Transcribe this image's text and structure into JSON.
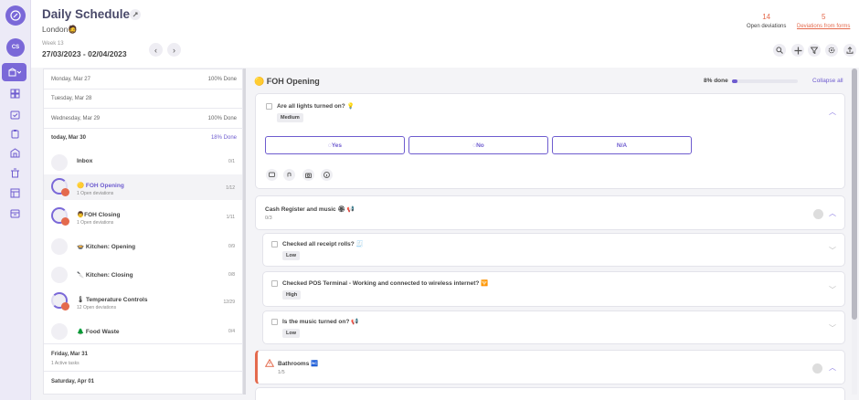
{
  "header": {
    "title": "Daily Schedule",
    "location": "London🧔",
    "week_label": "Week 13",
    "date_range": "27/03/2023 - 02/04/2023",
    "open_deviations_count": "14",
    "open_deviations_label": "Open deviations",
    "form_deviations_count": "5",
    "form_deviations_label": "Deviations from forms"
  },
  "user": {
    "initials": "CS"
  },
  "days": [
    {
      "name": "Monday, Mar 27",
      "pct": "100% Done"
    },
    {
      "name": "Tuesday, Mar 28",
      "pct": ""
    },
    {
      "name": "Wednesday, Mar 29",
      "pct": "100% Done"
    },
    {
      "name": "today, Mar 30",
      "pct": "18% Done"
    }
  ],
  "tasks": [
    {
      "name": "Inbox",
      "sub": "",
      "count": "0/1"
    },
    {
      "name": "🟡 FOH Opening",
      "sub": "1 Open deviations",
      "count": "1/12"
    },
    {
      "name": "👨FOH Closing",
      "sub": "1 Open deviations",
      "count": "1/11"
    },
    {
      "name": "🍲 Kitchen: Opening",
      "sub": "",
      "count": "0/9"
    },
    {
      "name": "🔪 Kitchen: Closing",
      "sub": "",
      "count": "0/8"
    },
    {
      "name": "🌡 Temperature Controls",
      "sub": "12 Open deviations",
      "count": "12/29"
    },
    {
      "name": "🌲 Food Waste",
      "sub": "",
      "count": "0/4"
    }
  ],
  "later_days": [
    {
      "name": "Friday, Mar 31",
      "sub": "1 Active tasks"
    },
    {
      "name": "Saturday, Apr 01",
      "sub": ""
    }
  ],
  "checklist": {
    "title": "🟡 FOH Opening",
    "progress_label": "8% done",
    "progress": 0.08,
    "collapse_all": "Collapse all"
  },
  "q1": {
    "text": "Are all lights turned on? 💡",
    "priority": "Medium",
    "yes": "Yes",
    "no": "No",
    "na": "N/A"
  },
  "section_cash": {
    "title": "Cash Register and music 🏵 📢",
    "count": "0/3"
  },
  "q2": {
    "text": "Checked all receipt rolls? 🧾",
    "priority": "Low"
  },
  "q3": {
    "text": "Checked POS Terminal - Working and connected to wireless internet? 🛜",
    "priority": "High"
  },
  "q4": {
    "text": "Is the music turned on? 📢",
    "priority": "Low"
  },
  "section_bath": {
    "title": "Bathrooms 🚾",
    "count": "1/5"
  },
  "colors": {
    "accent": "#7a68d8",
    "alert": "#e46a4d"
  }
}
